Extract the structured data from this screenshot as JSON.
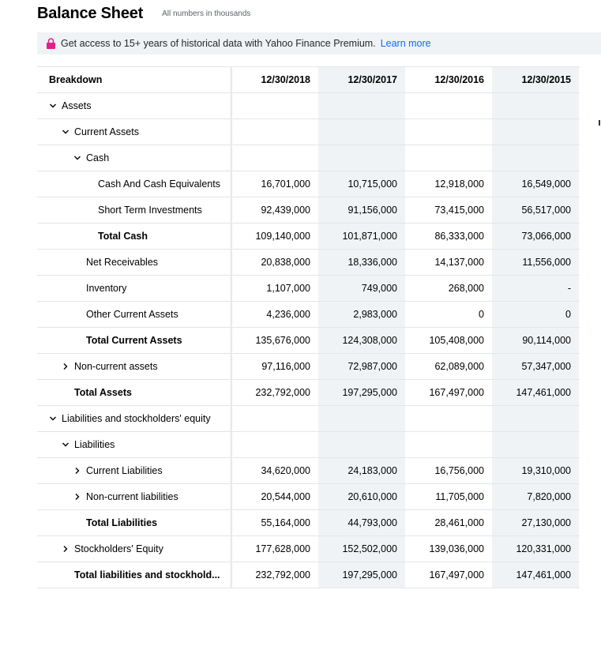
{
  "page": {
    "title": "Balance Sheet",
    "subtitle": "All numbers in thousands"
  },
  "banner": {
    "text": "Get access to 15+ years of historical data with Yahoo Finance Premium.",
    "link_label": "Learn more",
    "accent_color": "#0f69ff",
    "lock_color": "#e0218a"
  },
  "table": {
    "header": {
      "label": "Breakdown",
      "dates": [
        "12/30/2018",
        "12/30/2017",
        "12/30/2016",
        "12/30/2015"
      ]
    },
    "rows": [
      {
        "label": "Assets",
        "indent": 0,
        "toggle": "expanded",
        "bold": false,
        "values": [
          "",
          "",
          "",
          ""
        ]
      },
      {
        "label": "Current Assets",
        "indent": 1,
        "toggle": "expanded",
        "bold": false,
        "values": [
          "",
          "",
          "",
          ""
        ]
      },
      {
        "label": "Cash",
        "indent": 2,
        "toggle": "expanded",
        "bold": false,
        "values": [
          "",
          "",
          "",
          ""
        ]
      },
      {
        "label": "Cash And Cash Equivalents",
        "indent": 3,
        "toggle": "none",
        "bold": false,
        "values": [
          "16,701,000",
          "10,715,000",
          "12,918,000",
          "16,549,000"
        ]
      },
      {
        "label": "Short Term Investments",
        "indent": 3,
        "toggle": "none",
        "bold": false,
        "values": [
          "92,439,000",
          "91,156,000",
          "73,415,000",
          "56,517,000"
        ]
      },
      {
        "label": "Total Cash",
        "indent": 3,
        "toggle": "none",
        "bold": true,
        "values": [
          "109,140,000",
          "101,871,000",
          "86,333,000",
          "73,066,000"
        ]
      },
      {
        "label": "Net Receivables",
        "indent": 2,
        "toggle": "none",
        "bold": false,
        "values": [
          "20,838,000",
          "18,336,000",
          "14,137,000",
          "11,556,000"
        ]
      },
      {
        "label": "Inventory",
        "indent": 2,
        "toggle": "none",
        "bold": false,
        "values": [
          "1,107,000",
          "749,000",
          "268,000",
          "-"
        ]
      },
      {
        "label": "Other Current Assets",
        "indent": 2,
        "toggle": "none",
        "bold": false,
        "values": [
          "4,236,000",
          "2,983,000",
          "0",
          "0"
        ]
      },
      {
        "label": "Total Current Assets",
        "indent": 2,
        "toggle": "none",
        "bold": true,
        "values": [
          "135,676,000",
          "124,308,000",
          "105,408,000",
          "90,114,000"
        ]
      },
      {
        "label": "Non-current assets",
        "indent": 1,
        "toggle": "collapsed",
        "bold": false,
        "values": [
          "97,116,000",
          "72,987,000",
          "62,089,000",
          "57,347,000"
        ]
      },
      {
        "label": "Total Assets",
        "indent": 1,
        "toggle": "none",
        "bold": true,
        "values": [
          "232,792,000",
          "197,295,000",
          "167,497,000",
          "147,461,000"
        ]
      },
      {
        "label": "Liabilities and stockholders' equity",
        "indent": 0,
        "toggle": "expanded",
        "bold": false,
        "values": [
          "",
          "",
          "",
          ""
        ]
      },
      {
        "label": "Liabilities",
        "indent": 1,
        "toggle": "expanded",
        "bold": false,
        "values": [
          "",
          "",
          "",
          ""
        ]
      },
      {
        "label": "Current Liabilities",
        "indent": 2,
        "toggle": "collapsed",
        "bold": false,
        "values": [
          "34,620,000",
          "24,183,000",
          "16,756,000",
          "19,310,000"
        ]
      },
      {
        "label": "Non-current liabilities",
        "indent": 2,
        "toggle": "collapsed",
        "bold": false,
        "values": [
          "20,544,000",
          "20,610,000",
          "11,705,000",
          "7,820,000"
        ]
      },
      {
        "label": "Total Liabilities",
        "indent": 2,
        "toggle": "none",
        "bold": true,
        "values": [
          "55,164,000",
          "44,793,000",
          "28,461,000",
          "27,130,000"
        ]
      },
      {
        "label": "Stockholders' Equity",
        "indent": 1,
        "toggle": "collapsed",
        "bold": false,
        "values": [
          "177,628,000",
          "152,502,000",
          "139,036,000",
          "120,331,000"
        ]
      },
      {
        "label": "Total liabilities and stockhold...",
        "indent": 1,
        "toggle": "none",
        "bold": true,
        "values": [
          "232,792,000",
          "197,295,000",
          "167,497,000",
          "147,461,000"
        ]
      }
    ]
  }
}
